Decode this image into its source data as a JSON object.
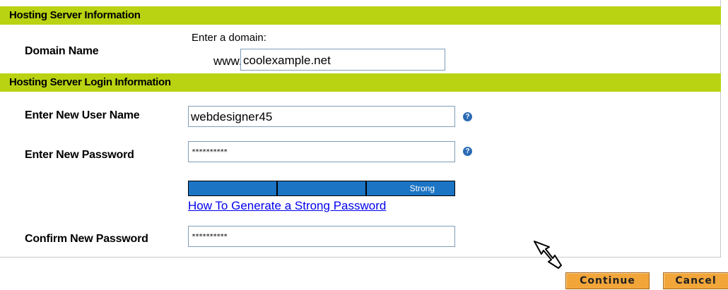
{
  "sections": {
    "hosting_server": {
      "title": "Hosting Server Information"
    },
    "login_info": {
      "title": "Hosting Server Login Information"
    }
  },
  "domain": {
    "label": "Domain Name",
    "prompt": "Enter a domain:",
    "prefix": "www.",
    "value": "coolexample.net"
  },
  "username": {
    "label": "Enter New User Name",
    "value": "webdesigner45"
  },
  "password": {
    "label": "Enter New Password",
    "value": "**********"
  },
  "strength": {
    "segments": [
      "",
      "",
      "Strong"
    ],
    "link_text": "How To Generate a Strong Password"
  },
  "confirm_password": {
    "label": "Confirm New Password",
    "value": "**********"
  },
  "buttons": {
    "continue_label": "Continue",
    "cancel_label": "Cancel"
  },
  "colors": {
    "header_green": "#b9d312",
    "meter_blue": "#1b74c4",
    "button_orange": "#f2a63a",
    "link_blue": "#0000ee"
  },
  "icons": {
    "help": "question-mark-icon",
    "cursor": "pointer-hand-icon"
  },
  "help_icon_glyph": "?"
}
